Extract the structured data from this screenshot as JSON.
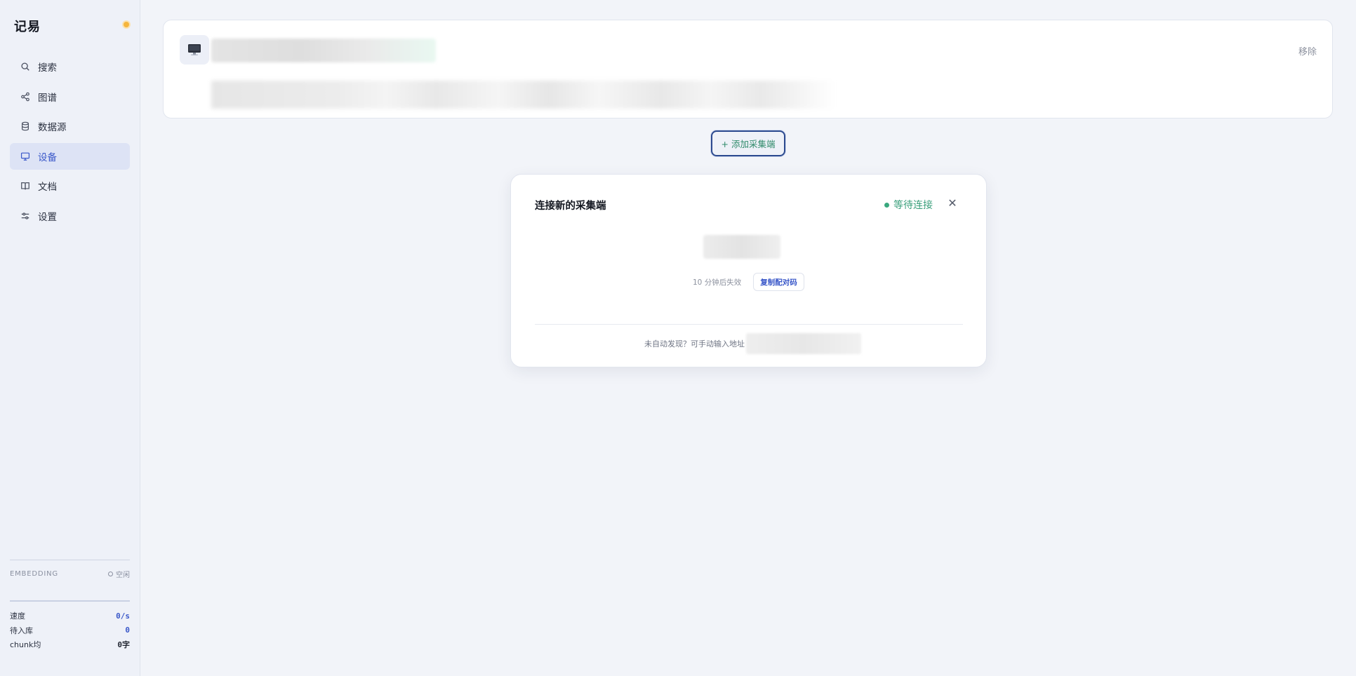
{
  "app": {
    "title": "记易",
    "theme_color": "#f5b53d"
  },
  "sidebar": {
    "items": [
      {
        "label": "搜索",
        "icon": "search-icon",
        "active": false
      },
      {
        "label": "图谱",
        "icon": "graph-icon",
        "active": false
      },
      {
        "label": "数据源",
        "icon": "database-icon",
        "active": false
      },
      {
        "label": "设备",
        "icon": "monitor-icon",
        "active": true
      },
      {
        "label": "文档",
        "icon": "book-icon",
        "active": false
      },
      {
        "label": "设置",
        "icon": "sliders-icon",
        "active": false
      }
    ],
    "embedding": {
      "label": "EMBEDDING",
      "status": "空闲"
    },
    "stats": [
      {
        "label": "速度",
        "value": "0/s"
      },
      {
        "label": "待入库",
        "value": "0"
      },
      {
        "label": "chunk均",
        "value": "0字"
      }
    ]
  },
  "device_card": {
    "icon": "computer-icon",
    "remove_label": "移除"
  },
  "add_button": {
    "label": "+ 添加采集端"
  },
  "pair_dialog": {
    "title": "连接新的采集端",
    "status": "等待连接",
    "status_color": "#3aa87e",
    "close_icon": "close-icon",
    "expire_text": "10 分钟后失效",
    "copy_label": "复制配对码",
    "manual_text": "未自动发现？可手动输入地址"
  },
  "colors": {
    "accent": "#3a58c9",
    "success": "#3a9f7b"
  }
}
